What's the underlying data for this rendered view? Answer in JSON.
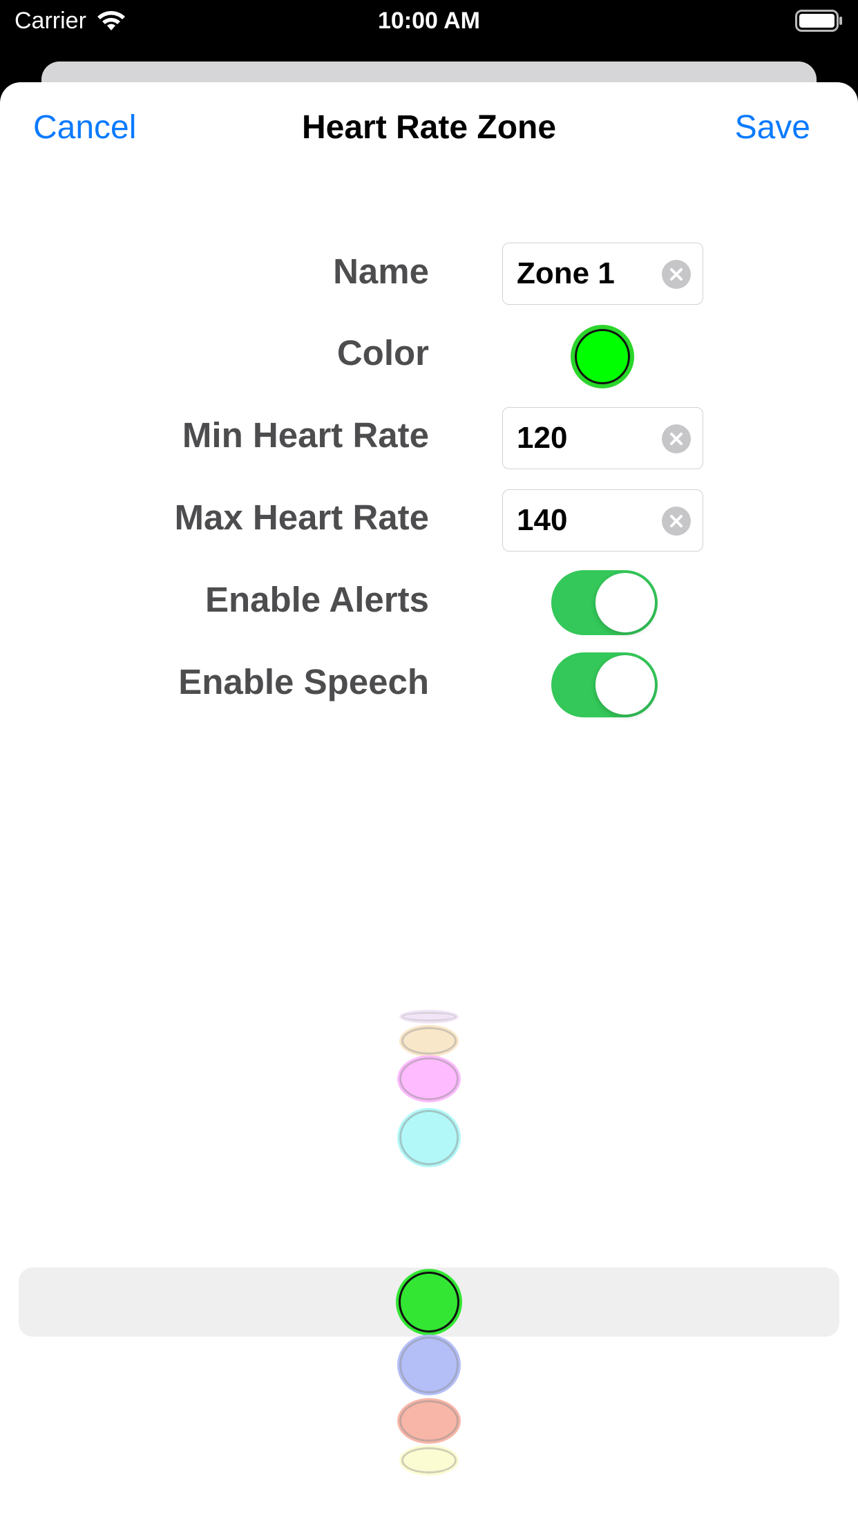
{
  "status_bar": {
    "carrier": "Carrier",
    "time": "10:00 AM"
  },
  "nav": {
    "cancel": "Cancel",
    "title": "Heart Rate Zone",
    "save": "Save"
  },
  "form": {
    "name_label": "Name",
    "name_value": "Zone 1",
    "color_label": "Color",
    "selected_color": "#00ff00",
    "min_label": "Min Heart Rate",
    "min_value": "120",
    "max_label": "Max Heart Rate",
    "max_value": "140",
    "alerts_label": "Enable Alerts",
    "alerts_on": true,
    "speech_label": "Enable Speech",
    "speech_on": true
  },
  "colors": {
    "accent": "#0a7aff",
    "toggle_on": "#34c759"
  },
  "color_picker": {
    "options": [
      "#e6cdf0",
      "#f7dfb8",
      "#ffb0ff",
      "#a6f7f7",
      "#33e633",
      "#a8b4f7",
      "#f7aa9a",
      "#fcfcc4"
    ],
    "selected_index": 4
  }
}
